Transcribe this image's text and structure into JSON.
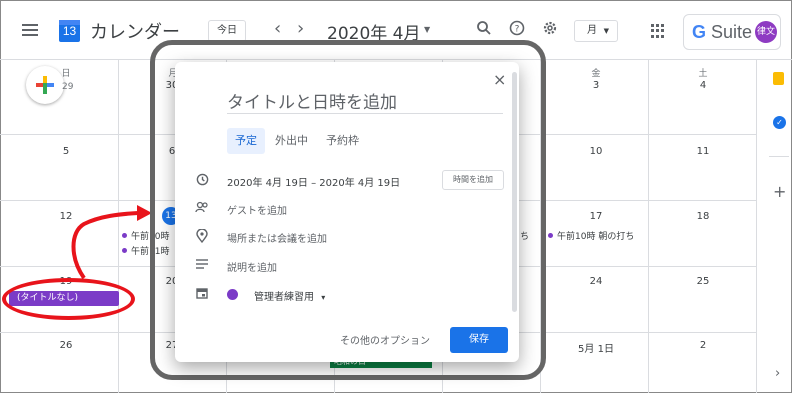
{
  "header": {
    "app_logo_day": "13",
    "app_title": "カレンダー",
    "today_label": "今日",
    "prev_label": "‹",
    "next_label": "›",
    "month_title": "2020年 4月",
    "view_label": "月",
    "brand_g": "G",
    "brand_rest": " Suite",
    "avatar_text": "律文"
  },
  "grid": {
    "dow_sun": "日",
    "dow_mon": "月",
    "dow_fri": "金",
    "dow_sat": "土",
    "days": {
      "r0c0": "29",
      "r0c1": "30",
      "r0c5": "3",
      "r0c6": "4",
      "r1c0": "5",
      "r1c1": "6",
      "r1c5": "10",
      "r1c6": "11",
      "r2c0": "12",
      "r2c1": "13",
      "r2c5": "17",
      "r2c6": "18",
      "r3c0": "19",
      "r3c1": "20",
      "r3c5": "24",
      "r3c6": "25",
      "r4c0": "26",
      "r4c1": "27",
      "r4c5": "5月 1日",
      "r4c6": "2"
    },
    "events": {
      "e13a": "午前10時",
      "e13b": "午前11時",
      "e16": "ち",
      "e17": "午前10時 朝の打ち",
      "untitled": "(タイトルなし)",
      "holiday": "昭和の日"
    }
  },
  "dialog": {
    "close": "×",
    "title_placeholder": "タイトルと日時を追加",
    "tabs": [
      "予定",
      "外出中",
      "予約枠"
    ],
    "date_range": "2020年 4月 19日  –  2020年 4月 19日",
    "add_time": "時間を追加",
    "add_guests": "ゲストを追加",
    "add_location": "場所または会議を追加",
    "add_description": "説明を追加",
    "calendar_name": "管理者練習用",
    "calendar_caret": "▾",
    "more_options": "その他のオプション",
    "save": "保存"
  },
  "side": {
    "add": "+",
    "expand": "›"
  },
  "colors": {
    "accent": "#1a73e8",
    "event_purple": "#7b3bc7",
    "highlight_red": "#e8141b",
    "holiday_green": "#0b8043"
  }
}
